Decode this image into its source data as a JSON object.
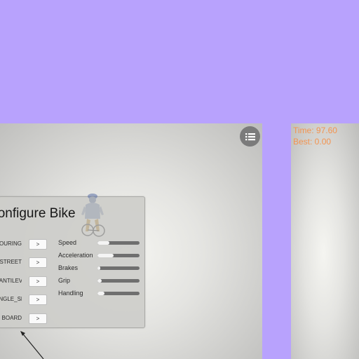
{
  "scene": {
    "menu_icon": "list-menu-icon"
  },
  "config": {
    "title": "Configure Bike",
    "button_label": ">",
    "bikes": [
      {
        "label": "TOURING"
      },
      {
        "label": "STREET"
      },
      {
        "label": "CANTILEVER"
      },
      {
        "label": "ANGLE_SLO"
      },
      {
        "label": "BOARD"
      }
    ],
    "stats": [
      {
        "label": "Speed",
        "value": 0.28
      },
      {
        "label": "Acceleration",
        "value": 0.38
      },
      {
        "label": "Brakes",
        "value": 0.07
      },
      {
        "label": "Grip",
        "value": 0.1
      },
      {
        "label": "Handling",
        "value": 0.16
      }
    ]
  },
  "hud": {
    "time": "Time: 97.60",
    "best": "Best: 0.00"
  },
  "colors": {
    "background": "#b8a2fd",
    "hud_text": "#f39450",
    "bar_track": "#6f6f6f",
    "bar_fill": "#f4f4f4"
  }
}
